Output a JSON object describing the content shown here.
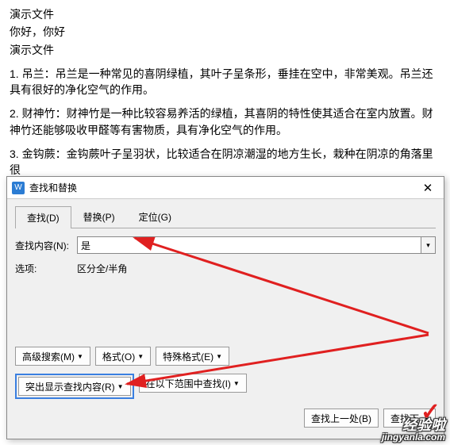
{
  "bg": {
    "l1": "演示文件",
    "l2": "你好，你好",
    "l3": "演示文件",
    "p1": "1. 吊兰：吊兰是一种常见的喜阴绿植，其叶子呈条形，垂挂在空中，非常美观。吊兰还具有很好的净化空气的作用。",
    "p2": "2. 财神竹：财神竹是一种比较容易养活的绿植，其喜阴的特性使其适合在室内放置。财神竹还能够吸收甲醛等有害物质，具有净化空气的作用。",
    "p3": "3. 金钩蕨：金钩蕨叶子呈羽状，比较适合在阴凉潮湿的地方生长，栽种在阴凉的角落里很"
  },
  "dialog": {
    "appIcon": "W",
    "title": "查找和替换",
    "tabs": {
      "find": "查找(D)",
      "replace": "替换(P)",
      "goto": "定位(G)"
    },
    "search": {
      "label": "查找内容(N):",
      "value": "是"
    },
    "options": {
      "label": "选项:",
      "value": "区分全/半角"
    },
    "buttons": {
      "advanced": "高级搜索(M)",
      "format": "格式(O)",
      "special": "特殊格式(E)",
      "highlight": "突出显示查找内容(R)",
      "searchIn": "在以下范围中查找(I)",
      "findPrev": "查找上一处(B)",
      "findNext": "查找下一"
    }
  },
  "watermark": {
    "line1": "经验啦",
    "line2": "jingyanla.com"
  }
}
